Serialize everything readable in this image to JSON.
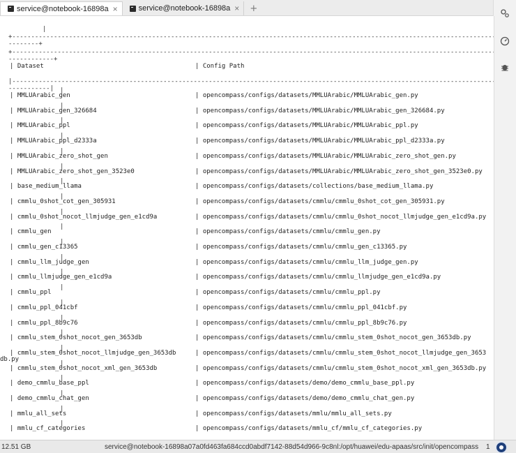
{
  "tabs": [
    {
      "label": "service@notebook-16898a",
      "close": "×",
      "active": true
    },
    {
      "label": "service@notebook-16898a",
      "close": "×",
      "active": false
    }
  ],
  "tab_add": "+",
  "right_icons": [
    "settings-icon",
    "dashboard-icon",
    "bug-icon"
  ],
  "table": {
    "top_border": "+------------------------------------------------------------------------------------------------------------------------------------------------------------",
    "wrap_border": "--------+",
    "header_border_a": "+------------------------------------------------------------------------------------------------------------------------------------------------------------",
    "header_border_b": "------------+",
    "header_left": "| Dataset",
    "header_right": "| Config Path",
    "sep_border": "|------------------------------------------------------------------------------------------------------------------------------------------------------------",
    "sep_border_b": "-----------|",
    "rows": [
      {
        "dataset": "| MMLUArabic_gen",
        "path": "| opencompass/configs/datasets/MMLUArabic/MMLUArabic_gen.py"
      },
      {
        "dataset": "| MMLUArabic_gen_326684",
        "path": "| opencompass/configs/datasets/MMLUArabic/MMLUArabic_gen_326684.py"
      },
      {
        "dataset": "| MMLUArabic_ppl",
        "path": "| opencompass/configs/datasets/MMLUArabic/MMLUArabic_ppl.py"
      },
      {
        "dataset": "| MMLUArabic_ppl_d2333a",
        "path": "| opencompass/configs/datasets/MMLUArabic/MMLUArabic_ppl_d2333a.py"
      },
      {
        "dataset": "| MMLUArabic_zero_shot_gen",
        "path": "| opencompass/configs/datasets/MMLUArabic/MMLUArabic_zero_shot_gen.py"
      },
      {
        "dataset": "| MMLUArabic_zero_shot_gen_3523e0",
        "path": "| opencompass/configs/datasets/MMLUArabic/MMLUArabic_zero_shot_gen_3523e0.py"
      },
      {
        "dataset": "| base_medium_llama",
        "path": "| opencompass/configs/datasets/collections/base_medium_llama.py"
      },
      {
        "dataset": "| cmmlu_0shot_cot_gen_305931",
        "path": "| opencompass/configs/datasets/cmmlu/cmmlu_0shot_cot_gen_305931.py"
      },
      {
        "dataset": "| cmmlu_0shot_nocot_llmjudge_gen_e1cd9a",
        "path": "| opencompass/configs/datasets/cmmlu/cmmlu_0shot_nocot_llmjudge_gen_e1cd9a.py"
      },
      {
        "dataset": "| cmmlu_gen",
        "path": "| opencompass/configs/datasets/cmmlu/cmmlu_gen.py"
      },
      {
        "dataset": "| cmmlu_gen_c13365",
        "path": "| opencompass/configs/datasets/cmmlu/cmmlu_gen_c13365.py"
      },
      {
        "dataset": "| cmmlu_llm_judge_gen",
        "path": "| opencompass/configs/datasets/cmmlu/cmmlu_llm_judge_gen.py"
      },
      {
        "dataset": "| cmmlu_llmjudge_gen_e1cd9a",
        "path": "| opencompass/configs/datasets/cmmlu/cmmlu_llmjudge_gen_e1cd9a.py"
      },
      {
        "dataset": "| cmmlu_ppl",
        "path": "| opencompass/configs/datasets/cmmlu/cmmlu_ppl.py"
      },
      {
        "dataset": "| cmmlu_ppl_041cbf",
        "path": "| opencompass/configs/datasets/cmmlu/cmmlu_ppl_041cbf.py"
      },
      {
        "dataset": "| cmmlu_ppl_8b9c76",
        "path": "| opencompass/configs/datasets/cmmlu/cmmlu_ppl_8b9c76.py"
      },
      {
        "dataset": "| cmmlu_stem_0shot_nocot_gen_3653db",
        "path": "| opencompass/configs/datasets/cmmlu/cmmlu_stem_0shot_nocot_gen_3653db.py"
      },
      {
        "dataset": "| cmmlu_stem_0shot_nocot_llmjudge_gen_3653db",
        "path": "| opencompass/configs/datasets/cmmlu/cmmlu_stem_0shot_nocot_llmjudge_gen_3653",
        "wrap": "db.py"
      },
      {
        "dataset": "| cmmlu_stem_0shot_nocot_xml_gen_3653db",
        "path": "| opencompass/configs/datasets/cmmlu/cmmlu_stem_0shot_nocot_xml_gen_3653db.py"
      },
      {
        "dataset": "| demo_cmmlu_base_ppl",
        "path": "| opencompass/configs/datasets/demo/demo_cmmlu_base_ppl.py"
      },
      {
        "dataset": "| demo_cmmlu_chat_gen",
        "path": "| opencompass/configs/datasets/demo/demo_cmmlu_chat_gen.py"
      },
      {
        "dataset": "| mmlu_all_sets",
        "path": "| opencompass/configs/datasets/mmlu/mmlu_all_sets.py"
      },
      {
        "dataset": "| mmlu_cf_categories",
        "path": "| opencompass/configs/datasets/mmlu_cf/mmlu_cf_categories.py"
      }
    ]
  },
  "status": {
    "memory": "12.51 GB",
    "path": "service@notebook-16898a07a0fd463fa684ccd0abdf7142-88d54d966-9c8nl:/opt/huawei/edu-apaas/src/init/opencompass",
    "count": "1"
  }
}
